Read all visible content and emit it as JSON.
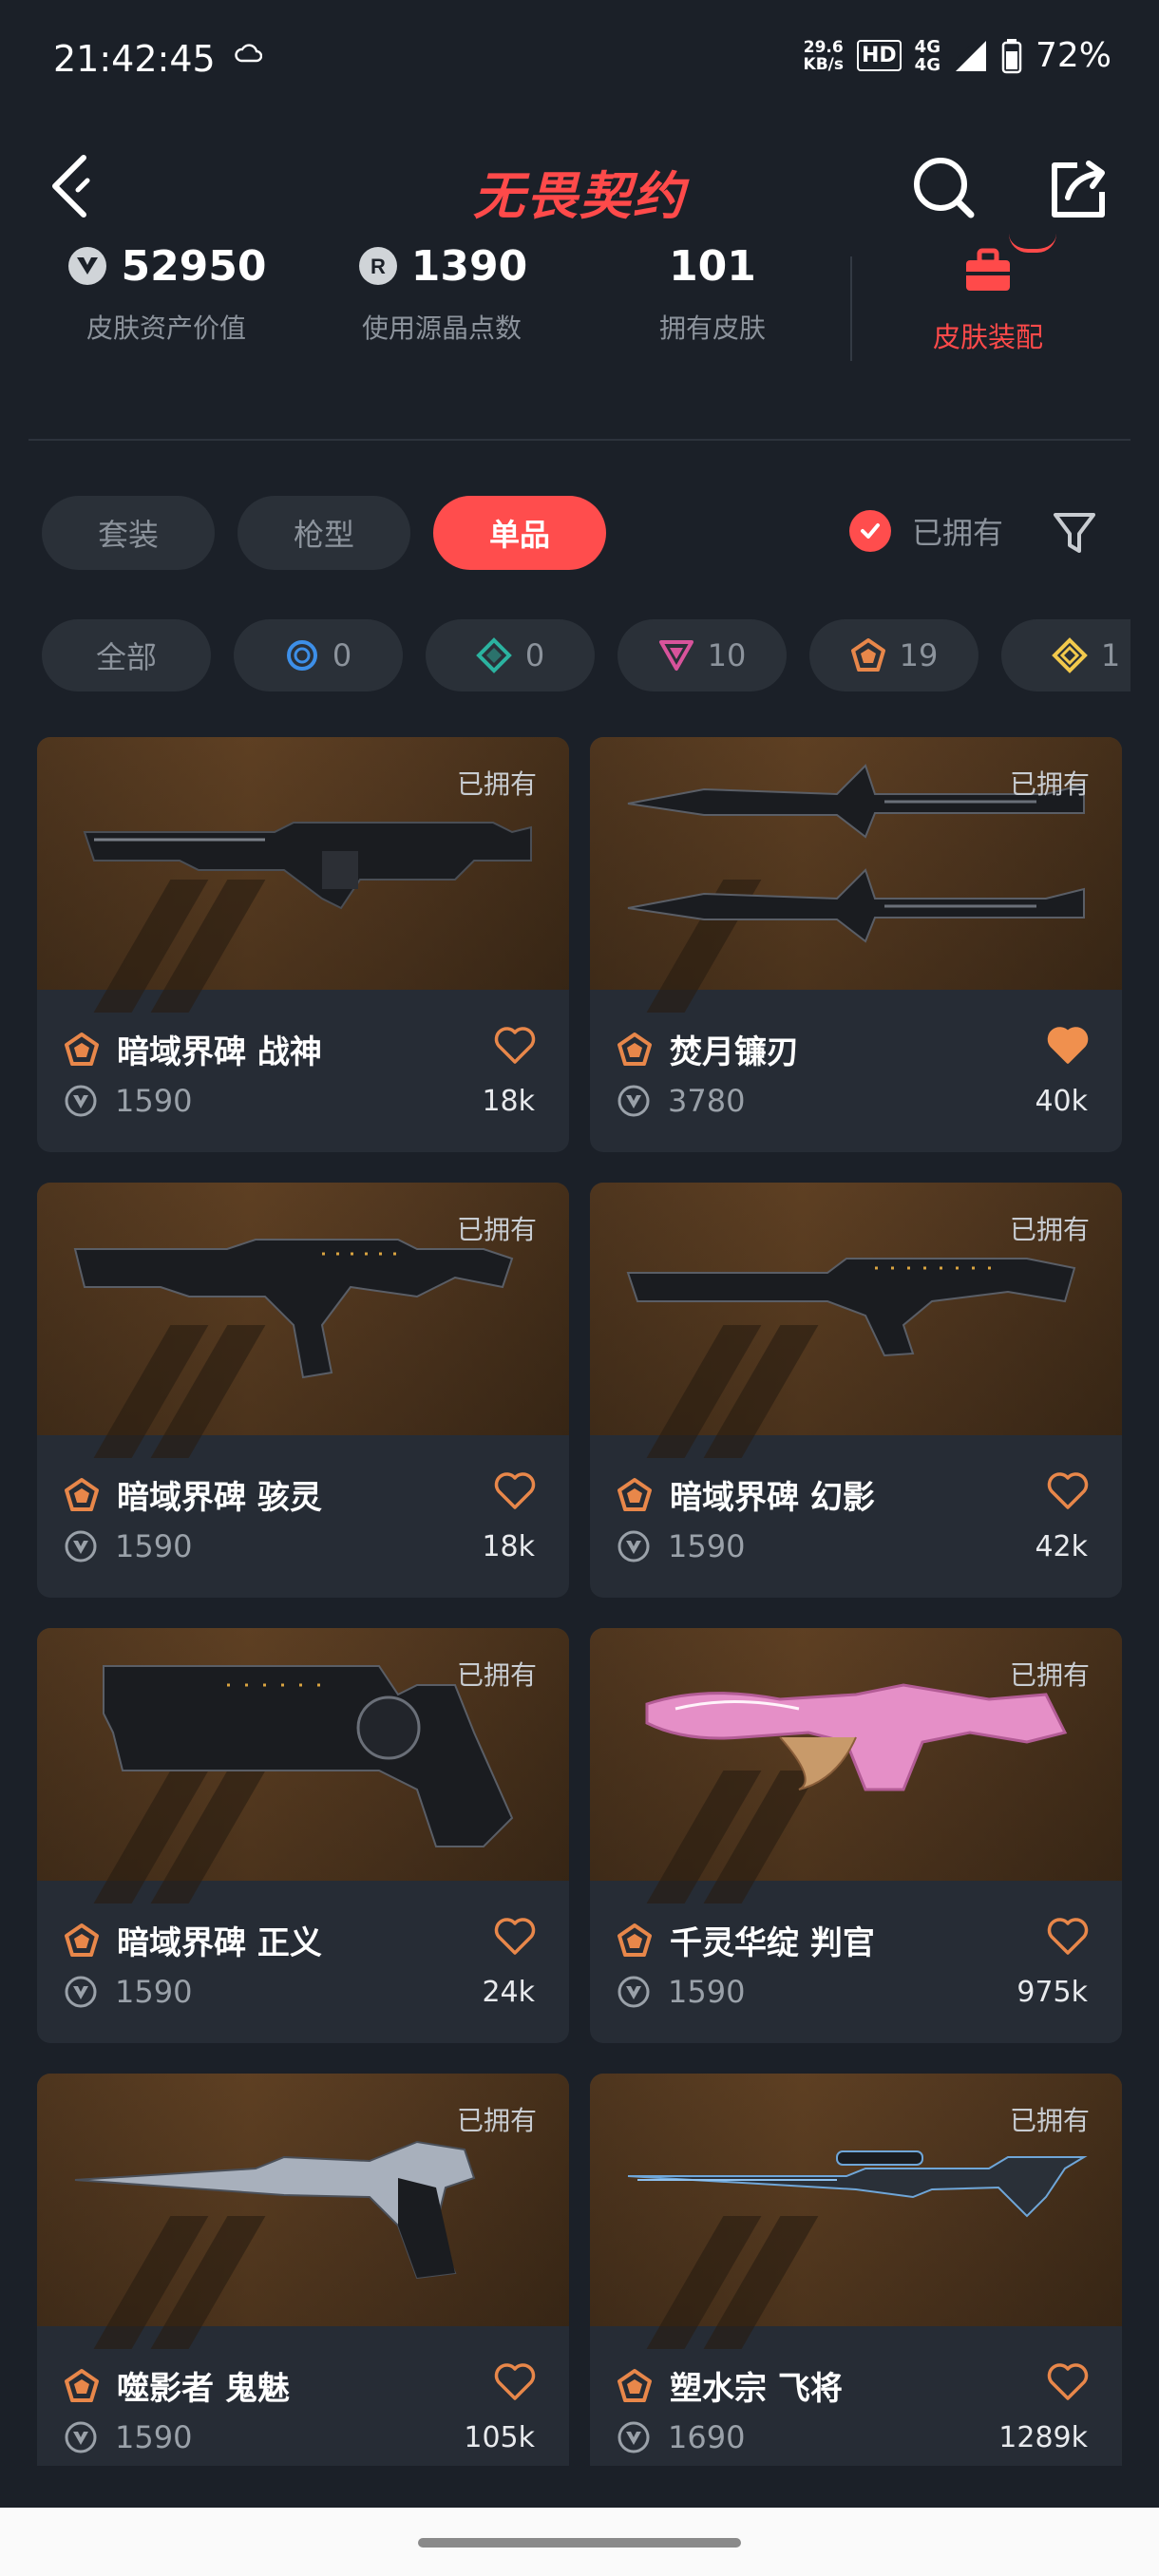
{
  "status": {
    "time": "21:42:45",
    "net_speed_value": "29.6",
    "net_speed_unit": "KB/s",
    "hd_label": "HD",
    "net_top": "4G",
    "net_bottom": "4G",
    "battery": "72%"
  },
  "header": {
    "title": "无畏契约"
  },
  "stats": {
    "asset_value": "52950",
    "asset_value_label": "皮肤资产价值",
    "radianite": "1390",
    "radianite_label": "使用源晶点数",
    "skins_owned": "101",
    "skins_owned_label": "拥有皮肤",
    "outfit_label": "皮肤装配"
  },
  "tabs": [
    {
      "label": "套装"
    },
    {
      "label": "枪型"
    },
    {
      "label": "单品"
    }
  ],
  "owned_toggle_label": "已拥有",
  "rarity_filters": [
    {
      "label": "全部"
    },
    {
      "label": "0",
      "icon": "select-tier-icon"
    },
    {
      "label": "0",
      "icon": "deluxe-tier-icon"
    },
    {
      "label": "10",
      "icon": "premium-tier-icon"
    },
    {
      "label": "19",
      "icon": "exclusive-tier-icon"
    },
    {
      "label": "1",
      "icon": "ultra-tier-icon"
    }
  ],
  "owned_tag": "已拥有",
  "skins": [
    {
      "name": "暗域界碑 战神",
      "price": "1590",
      "likes": "18k",
      "liked": false
    },
    {
      "name": "焚月镰刃",
      "price": "3780",
      "likes": "40k",
      "liked": true
    },
    {
      "name": "暗域界碑 骇灵",
      "price": "1590",
      "likes": "18k",
      "liked": false
    },
    {
      "name": "暗域界碑 幻影",
      "price": "1590",
      "likes": "42k",
      "liked": false
    },
    {
      "name": "暗域界碑 正义",
      "price": "1590",
      "likes": "24k",
      "liked": false
    },
    {
      "name": "千灵华绽 判官",
      "price": "1590",
      "likes": "975k",
      "liked": false
    },
    {
      "name": "噬影者 鬼魅",
      "price": "1590",
      "likes": "105k",
      "liked": false
    },
    {
      "name": "塑水宗 飞将",
      "price": "1690",
      "likes": "1289k",
      "liked": false
    }
  ],
  "colors": {
    "accent": "#ff4d4d",
    "exclusive": "#e8874a",
    "background": "#1b2028"
  }
}
